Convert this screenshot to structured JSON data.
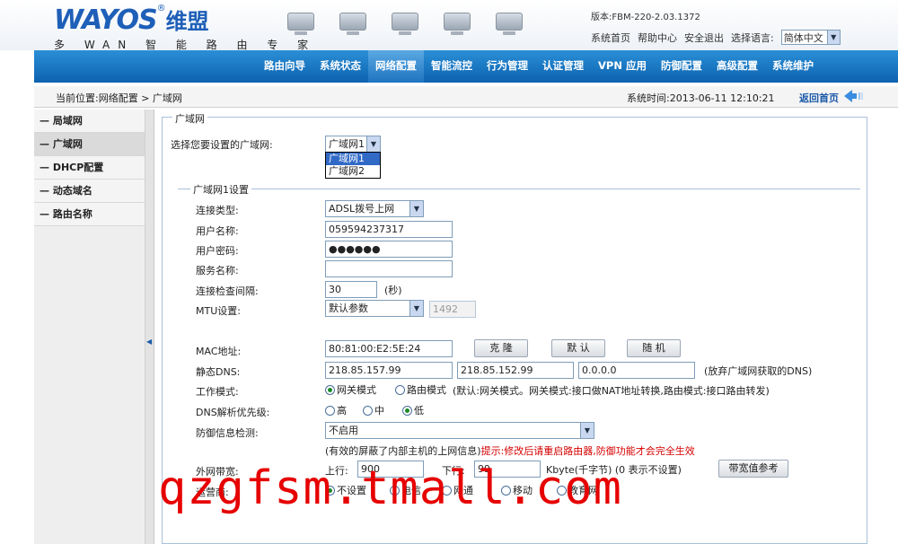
{
  "header": {
    "logo_text": "WAYOS",
    "logo_cn": "维盟",
    "logo_reg": "®",
    "logo_tagline": "多 WAN 智 能 路 由 专 家",
    "version_label": "版本:FBM-220-2.03.1372",
    "links": [
      "系统首页",
      "帮助中心",
      "安全退出",
      "选择语言:"
    ],
    "language_value": "简体中文"
  },
  "nav": {
    "items": [
      "路由向导",
      "系统状态",
      "网络配置",
      "智能流控",
      "行为管理",
      "认证管理",
      "VPN 应用",
      "防御配置",
      "高级配置",
      "系统维护"
    ],
    "active_index": 2
  },
  "breadcrumb": {
    "text": "当前位置:网络配置 > 广域网",
    "system_time": "系统时间:2013-06-11 12:10:21",
    "back_home": "返回首页"
  },
  "sidebar": {
    "items": [
      "— 局域网",
      "— 广域网",
      "— DHCP配置",
      "— 动态域名",
      "— 路由名称"
    ],
    "active_index": 1
  },
  "form": {
    "section_title": "广域网",
    "select_wan_label": "选择您要设置的广域网:",
    "select_wan_value": "广域网1",
    "wan_options": [
      "广域网1",
      "广域网2"
    ],
    "wan_settings_title": "广域网1设置",
    "conn_type_label": "连接类型:",
    "conn_type_value": "ADSL拨号上网",
    "username_label": "用户名称:",
    "username_value": "059594237317",
    "password_label": "用户密码:",
    "password_value": "●●●●●●",
    "service_label": "服务名称:",
    "service_value": "",
    "interval_label": "连接检查间隔:",
    "interval_value": "30",
    "interval_unit": "(秒)",
    "mtu_label": "MTU设置:",
    "mtu_value": "默认参数",
    "mtu_number": "1492",
    "mac_label": "MAC地址:",
    "mac_value": "80:81:00:E2:5E:24",
    "clone_button": "克 隆",
    "default_button": "默 认",
    "random_button": "随 机",
    "dns_label": "静态DNS:",
    "dns1": "218.85.157.99",
    "dns2": "218.85.152.99",
    "dns3": "0.0.0.0",
    "dns_note": "(放弃广域网获取的DNS)",
    "mode_label": "工作模式:",
    "mode_gateway": "网关模式",
    "mode_router": "路由模式",
    "mode_note": "(默认:网关模式。网关模式:接口做NAT地址转换,路由模式:接口路由转发)",
    "dns_priority_label": "DNS解析优先级:",
    "priority_high": "高",
    "priority_mid": "中",
    "priority_low": "低",
    "defense_label": "防御信息检测:",
    "defense_value": "不启用",
    "defense_note_black": "(有效的屏蔽了内部主机的上网信息)",
    "defense_note_red": "提示:修改后请重启路由器,防御功能才会完全生效",
    "bandwidth_label": "外网带宽:",
    "up_label": "上行:",
    "up_value": "900",
    "down_label": "下行:",
    "down_value": "99",
    "bw_unit": "Kbyte(千字节) (0 表示不设置)",
    "bw_ref_button": "带宽值参考",
    "isp_label": "运营商:",
    "isp_options": [
      "不设置",
      "电信",
      "网通",
      "移动",
      "教育网"
    ]
  },
  "watermark": "qzgfsm.tmall.com",
  "colors": {
    "nav_blue": "#0d62b0",
    "logo_blue": "#1e5fb8",
    "alert_red": "#d60000",
    "watermark_red": "#e60000"
  }
}
